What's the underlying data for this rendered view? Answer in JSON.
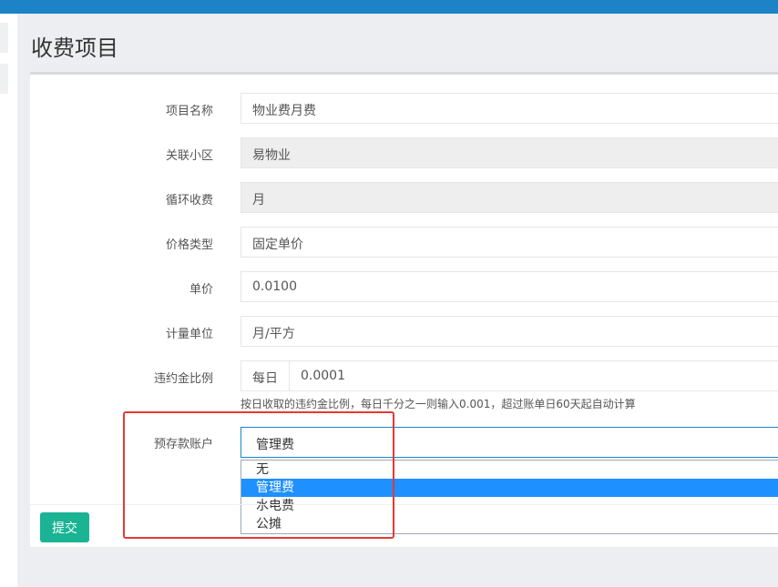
{
  "page": {
    "title": "收费项目"
  },
  "form": {
    "item_name": {
      "label": "项目名称",
      "value": "物业费月费"
    },
    "community": {
      "label": "关联小区",
      "value": "易物业"
    },
    "cycle": {
      "label": "循环收费",
      "value": "月"
    },
    "price_type": {
      "label": "价格类型",
      "value": "固定单价"
    },
    "unit_price": {
      "label": "单价",
      "value": "0.0100"
    },
    "unit": {
      "label": "计量单位",
      "value": "月/平方"
    },
    "penalty": {
      "label": "违约金比例",
      "addon": "每日",
      "value": "0.0001",
      "help": "按日收取的违约金比例，每日千分之一则输入0.001，超过账单日60天起自动计算"
    },
    "deposit_account": {
      "label": "预存款账户",
      "value": "管理费",
      "options": [
        "无",
        "管理费",
        "水电费",
        "公摊"
      ],
      "selected_index": 1
    }
  },
  "actions": {
    "submit_label": "提交"
  },
  "colors": {
    "accent": "#1c84c6",
    "submit": "#1ab394",
    "highlight": "#e53935",
    "option_selected": "#1e90ff"
  }
}
